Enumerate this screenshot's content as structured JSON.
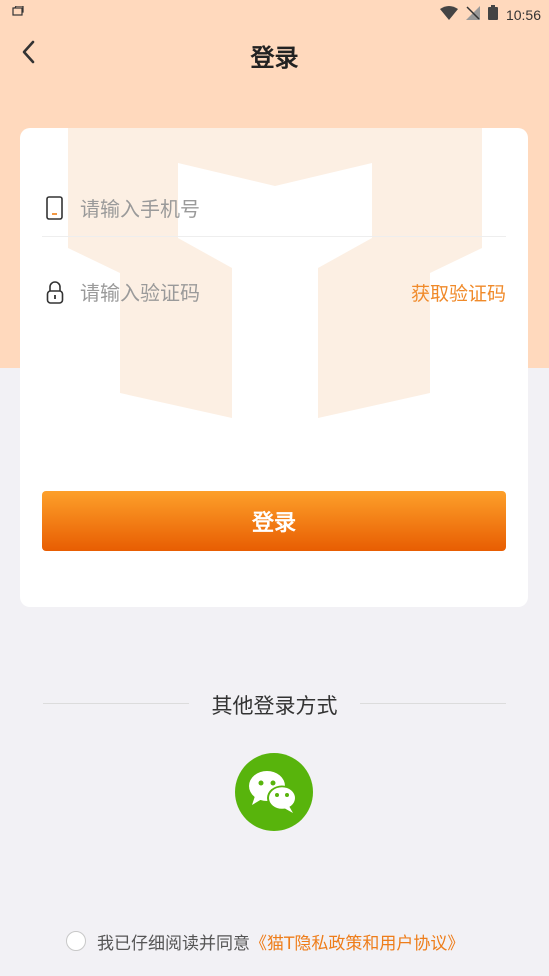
{
  "status_bar": {
    "time": "10:56"
  },
  "header": {
    "title": "登录"
  },
  "form": {
    "phone_placeholder": "请输入手机号",
    "phone_value": "",
    "code_placeholder": "请输入验证码",
    "code_value": "",
    "get_code_label": "获取验证码",
    "login_label": "登录"
  },
  "other_login": {
    "title": "其他登录方式",
    "wechat_icon": "wechat-icon"
  },
  "agreement": {
    "text": "我已仔细阅读并同意",
    "link": "《猫T隐私政策和用户协议》",
    "checked": false
  },
  "colors": {
    "header_bg": "#ffd9bd",
    "accent": "#f08a2a",
    "button_top": "#fda02a",
    "button_bottom": "#e85d02",
    "wechat_green": "#58b40c"
  }
}
